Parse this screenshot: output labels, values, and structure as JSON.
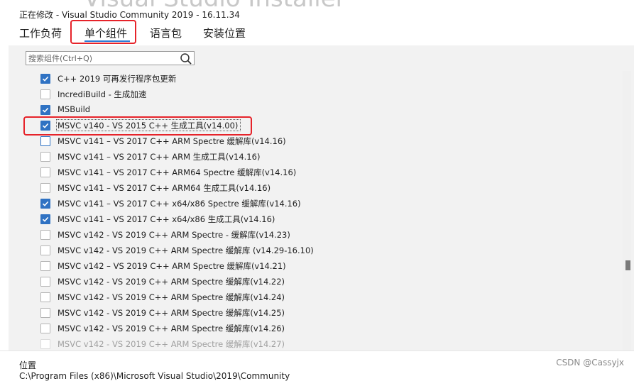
{
  "window": {
    "bg_title": "Visual Studio Installer",
    "modifying": "正在修改 - Visual Studio Community 2019 - 16.11.34"
  },
  "tabs": [
    {
      "label": "工作负荷",
      "active": false
    },
    {
      "label": "单个组件",
      "active": true
    },
    {
      "label": "语言包",
      "active": false
    },
    {
      "label": "安装位置",
      "active": false
    }
  ],
  "search": {
    "placeholder": "搜索组件(Ctrl+Q)",
    "value": ""
  },
  "components": [
    {
      "label": "C++ 2019 可再发行程序包更新",
      "checked": true
    },
    {
      "label": "IncrediBuild - 生成加速",
      "checked": false
    },
    {
      "label": "MSBuild",
      "checked": true
    },
    {
      "label": "MSVC v140 - VS 2015 C++ 生成工具(v14.00)",
      "checked": true,
      "focused": true
    },
    {
      "label": "MSVC v141 – VS 2017 C++ ARM Spectre 缓解库(v14.16)",
      "checked": false
    },
    {
      "label": "MSVC v141 – VS 2017 C++ ARM 生成工具(v14.16)",
      "checked": false
    },
    {
      "label": "MSVC v141 – VS 2017 C++ ARM64 Spectre 缓解库(v14.16)",
      "checked": false
    },
    {
      "label": "MSVC v141 – VS 2017 C++ ARM64 生成工具(v14.16)",
      "checked": false
    },
    {
      "label": "MSVC v141 – VS 2017 C++ x64/x86 Spectre 缓解库(v14.16)",
      "checked": true
    },
    {
      "label": "MSVC v141 – VS 2017 C++ x64/x86 生成工具(v14.16)",
      "checked": true
    },
    {
      "label": "MSVC v142 - VS 2019 C++ ARM Spectre - 缓解库(v14.23)",
      "checked": false
    },
    {
      "label": "MSVC v142 - VS 2019 C++ ARM Spectre 缓解库 (v14.29-16.10)",
      "checked": false
    },
    {
      "label": "MSVC v142 – VS 2019 C++ ARM Spectre 缓解库(v14.21)",
      "checked": false
    },
    {
      "label": "MSVC v142 - VS 2019 C++ ARM Spectre 缓解库(v14.22)",
      "checked": false
    },
    {
      "label": "MSVC v142 - VS 2019 C++ ARM Spectre 缓解库(v14.24)",
      "checked": false
    },
    {
      "label": "MSVC v142 - VS 2019 C++ ARM Spectre 缓解库(v14.25)",
      "checked": false
    },
    {
      "label": "MSVC v142 - VS 2019 C++ ARM Spectre 缓解库(v14.26)",
      "checked": false
    },
    {
      "label": "MSVC v142 - VS 2019 C++ ARM Spectre 缓解库(v14.27)",
      "checked": false,
      "faded": true
    }
  ],
  "footer": {
    "location_label": "位置",
    "location_path": "C:\\Program Files (x86)\\Microsoft Visual Studio\\2019\\Community",
    "watermark": "CSDN @Cassyjx"
  },
  "colors": {
    "accent": "#2f72c3",
    "highlight": "#e6232a"
  }
}
